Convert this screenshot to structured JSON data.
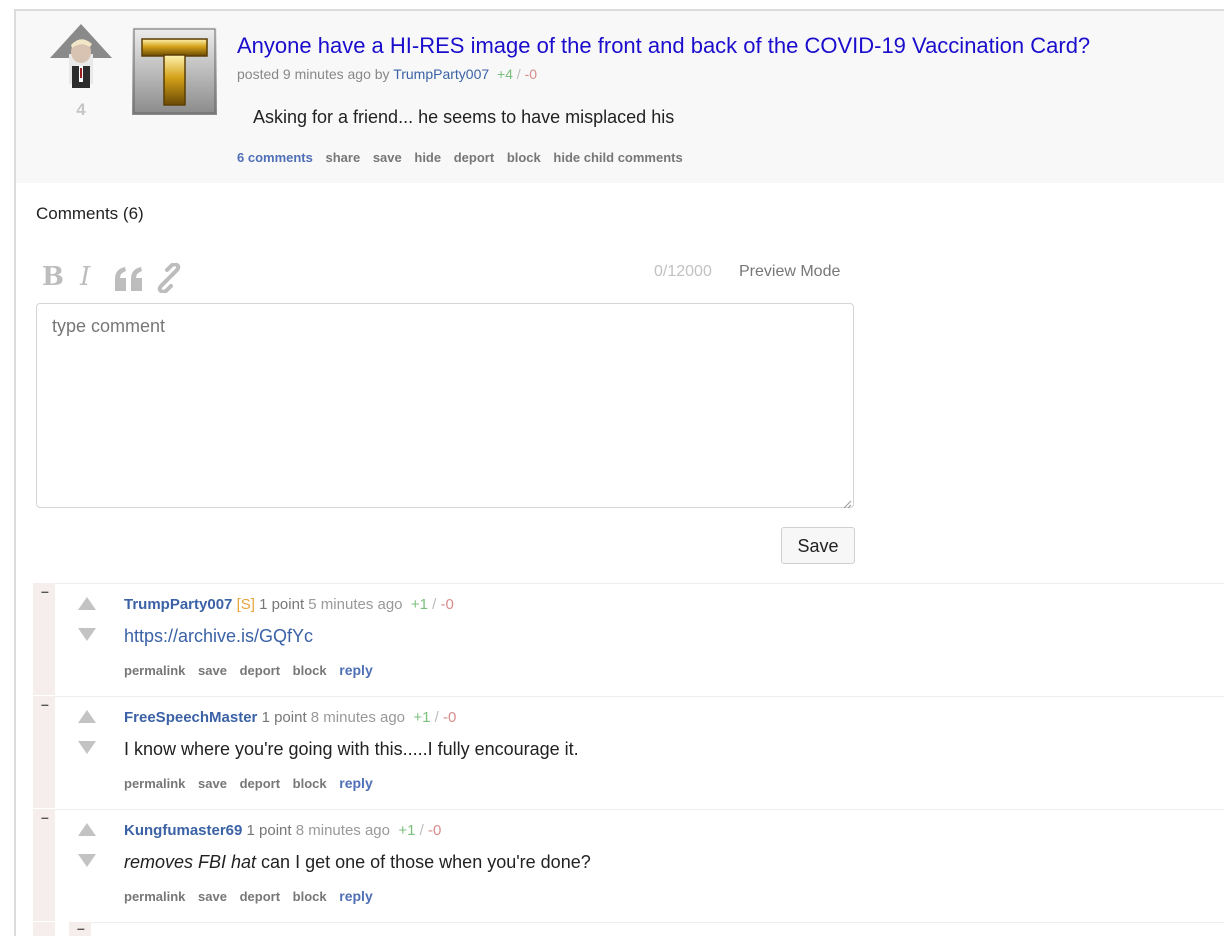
{
  "post": {
    "title": "Anyone have a HI-RES image of the front and back of the COVID-19 Vaccination Card?",
    "score": "4",
    "meta_prefix": "posted 9 minutes ago by",
    "author": "TrumpParty007",
    "upvotes": "+4",
    "vote_sep": "/",
    "downvotes": "-0",
    "body": "Asking for a friend... he seems to have misplaced his",
    "actions": {
      "comments": "6 comments",
      "share": "share",
      "save": "save",
      "hide": "hide",
      "deport": "deport",
      "block": "block",
      "hide_child": "hide child comments"
    }
  },
  "comments_heading": "Comments (6)",
  "editor": {
    "bold": "B",
    "italic": "I",
    "quote": "66",
    "char_count": "0/12000",
    "preview_mode": "Preview Mode",
    "placeholder": "type comment",
    "save_label": "Save"
  },
  "comments": [
    {
      "collapse": "–",
      "author": "TrumpParty007",
      "tag": "[S]",
      "points": "1 point",
      "time": "5 minutes ago",
      "up": "+1",
      "sep": "/",
      "down": "-0",
      "body": "https://archive.is/GQfYc",
      "is_link": true,
      "actions": {
        "permalink": "permalink",
        "save": "save",
        "deport": "deport",
        "block": "block",
        "reply": "reply"
      }
    },
    {
      "collapse": "–",
      "author": "FreeSpeechMaster",
      "tag": "",
      "points": "1 point",
      "time": "8 minutes ago",
      "up": "+1",
      "sep": "/",
      "down": "-0",
      "body": "I know where you're going with this.....I fully encourage it.",
      "is_link": false,
      "actions": {
        "permalink": "permalink",
        "save": "save",
        "deport": "deport",
        "block": "block",
        "reply": "reply"
      }
    },
    {
      "collapse": "–",
      "author": "Kungfumaster69",
      "tag": "",
      "points": "1 point",
      "time": "8 minutes ago",
      "up": "+1",
      "sep": "/",
      "down": "-0",
      "body_italic": "removes FBI hat",
      "body_rest": " can I get one of those when you're done?",
      "is_link": false,
      "actions": {
        "permalink": "permalink",
        "save": "save",
        "deport": "deport",
        "block": "block",
        "reply": "reply"
      }
    }
  ],
  "child_stub_collapse": "–",
  "icons": {
    "avatar": "trump-avatar-icon",
    "thumbnail": "gold-t-icon",
    "link": "link-icon",
    "quote": "quote-icon"
  },
  "colors": {
    "title": "#1a0dcc",
    "author": "#3b62a6",
    "upvote": "#7cbf7c",
    "downvote": "#d78c8c",
    "submitter_tag": "#e8a33a",
    "comment_bar": "#f6eeec"
  }
}
